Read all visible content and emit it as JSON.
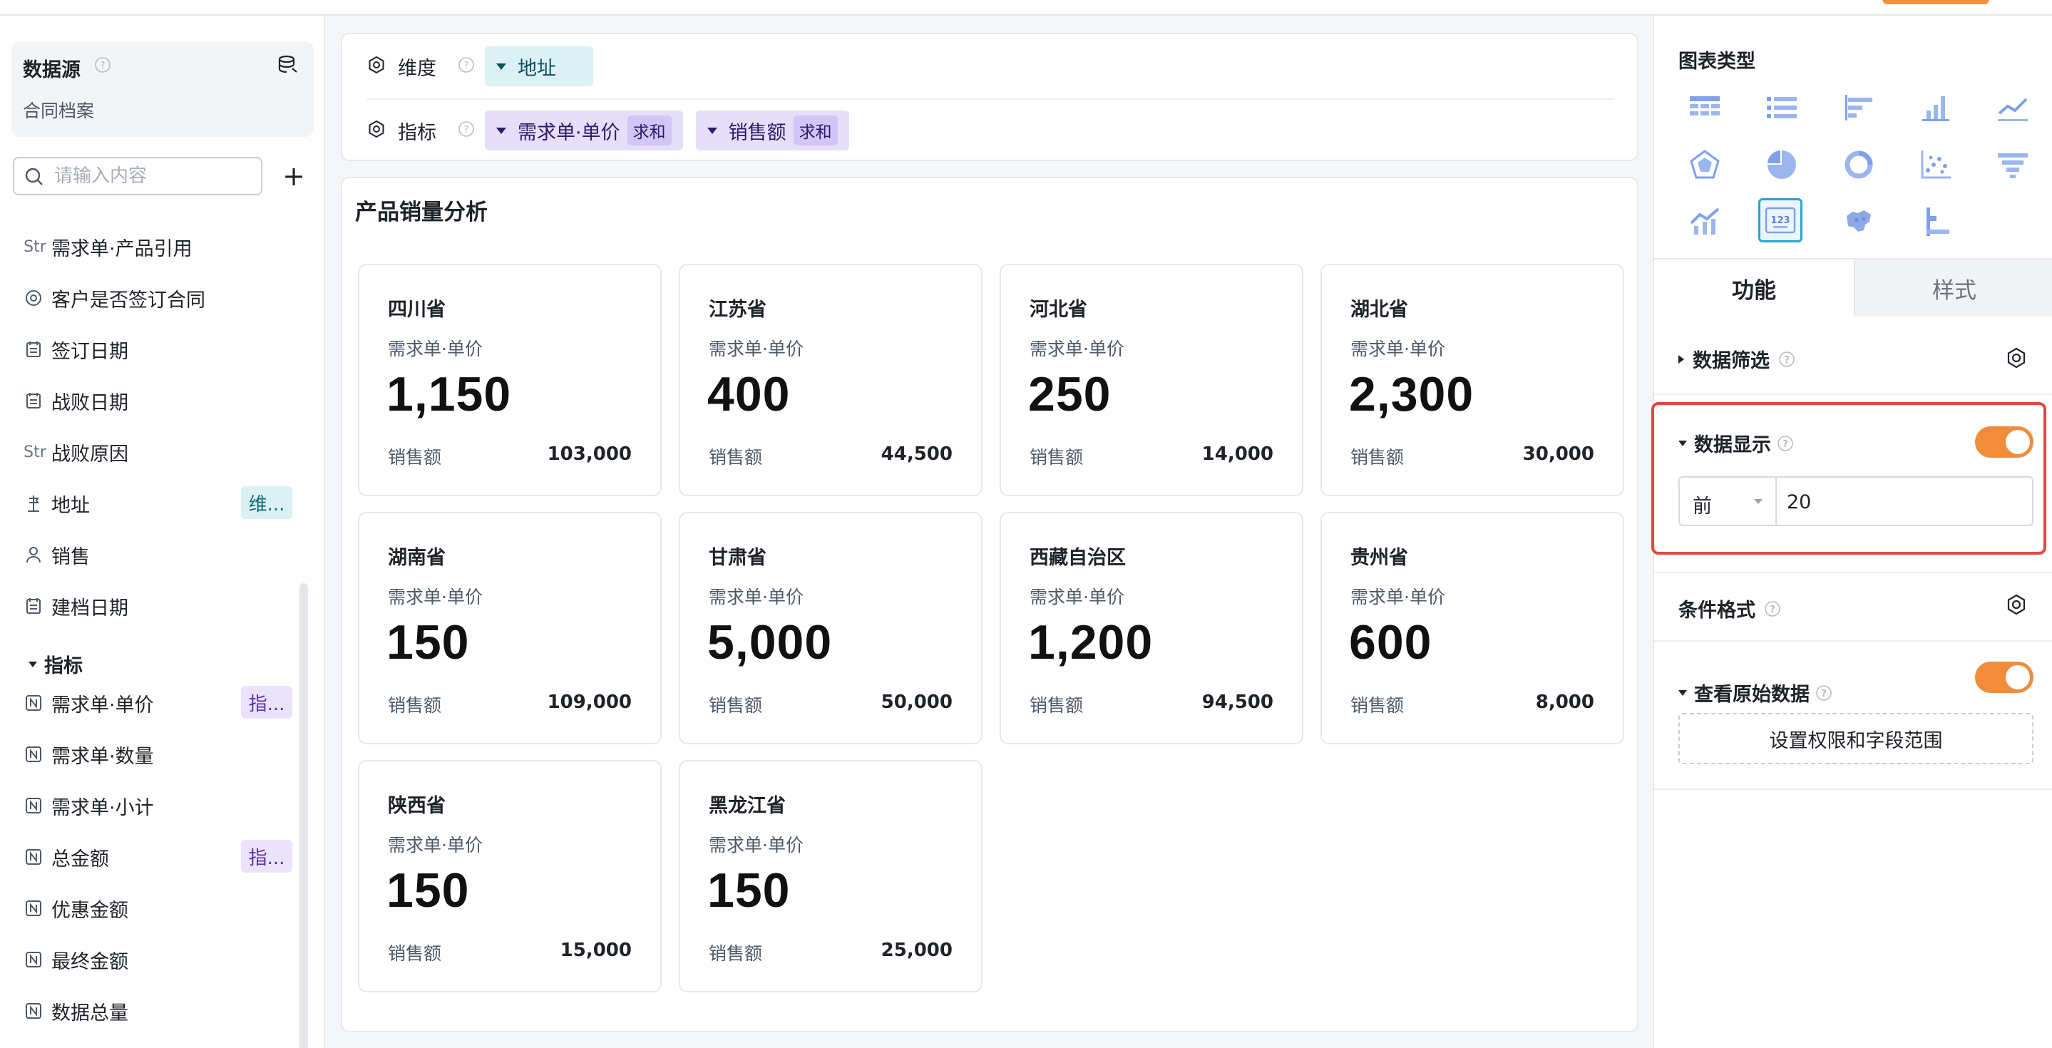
{
  "sidebar": {
    "datasource_title": "数据源",
    "datasource_name": "合同档案",
    "search_placeholder": "请输入内容",
    "fields": [
      {
        "type": "Str",
        "label": "需求单·产品引用",
        "icon": "string-icon",
        "tag": ""
      },
      {
        "type": "enum",
        "label": "客户是否签订合同",
        "icon": "enum-icon",
        "tag": ""
      },
      {
        "type": "date",
        "label": "签订日期",
        "icon": "calendar-icon",
        "tag": ""
      },
      {
        "type": "date",
        "label": "战败日期",
        "icon": "calendar-icon",
        "tag": ""
      },
      {
        "type": "Str",
        "label": "战败原因",
        "icon": "string-icon",
        "tag": ""
      },
      {
        "type": "geo",
        "label": "地址",
        "icon": "location-icon",
        "tag": "维..."
      },
      {
        "type": "user",
        "label": "销售",
        "icon": "user-icon",
        "tag": ""
      },
      {
        "type": "date",
        "label": "建档日期",
        "icon": "calendar-icon",
        "tag": ""
      }
    ],
    "metrics_section": "指标",
    "metrics": [
      {
        "label": "需求单·单价",
        "icon": "number-icon",
        "tag": "指..."
      },
      {
        "label": "需求单·数量",
        "icon": "number-icon",
        "tag": ""
      },
      {
        "label": "需求单·小计",
        "icon": "number-icon",
        "tag": ""
      },
      {
        "label": "总金额",
        "icon": "number-icon",
        "tag": "指..."
      },
      {
        "label": "优惠金额",
        "icon": "number-icon",
        "tag": ""
      },
      {
        "label": "最终金额",
        "icon": "number-icon",
        "tag": ""
      },
      {
        "label": "数据总量",
        "icon": "number-icon",
        "tag": ""
      }
    ]
  },
  "config": {
    "dimension_label": "维度",
    "dimension_pill": "地址",
    "metric_label": "指标",
    "metric_pills": [
      {
        "label": "需求单·单价",
        "agg": "求和"
      },
      {
        "label": "销售额",
        "agg": "求和"
      }
    ]
  },
  "panel": {
    "title": "产品销量分析",
    "cards": [
      {
        "province": "四川省",
        "metric": "需求单·单价",
        "value": "1,150",
        "sub_label": "销售额",
        "sub_value": "103,000"
      },
      {
        "province": "江苏省",
        "metric": "需求单·单价",
        "value": "400",
        "sub_label": "销售额",
        "sub_value": "44,500"
      },
      {
        "province": "河北省",
        "metric": "需求单·单价",
        "value": "250",
        "sub_label": "销售额",
        "sub_value": "14,000"
      },
      {
        "province": "湖北省",
        "metric": "需求单·单价",
        "value": "2,300",
        "sub_label": "销售额",
        "sub_value": "30,000"
      },
      {
        "province": "湖南省",
        "metric": "需求单·单价",
        "value": "150",
        "sub_label": "销售额",
        "sub_value": "109,000"
      },
      {
        "province": "甘肃省",
        "metric": "需求单·单价",
        "value": "5,000",
        "sub_label": "销售额",
        "sub_value": "50,000"
      },
      {
        "province": "西藏自治区",
        "metric": "需求单·单价",
        "value": "1,200",
        "sub_label": "销售额",
        "sub_value": "94,500"
      },
      {
        "province": "贵州省",
        "metric": "需求单·单价",
        "value": "600",
        "sub_label": "销售额",
        "sub_value": "8,000"
      },
      {
        "province": "陕西省",
        "metric": "需求单·单价",
        "value": "150",
        "sub_label": "销售额",
        "sub_value": "15,000"
      },
      {
        "province": "黑龙江省",
        "metric": "需求单·单价",
        "value": "150",
        "sub_label": "销售额",
        "sub_value": "25,000"
      }
    ]
  },
  "right": {
    "chart_type_title": "图表类型",
    "chart_types": [
      "table-icon",
      "list-icon",
      "horizontal-bar-icon",
      "bar-chart-icon",
      "line-chart-icon",
      "radar-icon",
      "pie-icon",
      "donut-icon",
      "scatter-icon",
      "funnel-icon",
      "combo-chart-icon",
      "indicator-card-icon",
      "map-icon",
      "gantt-icon"
    ],
    "selected_chart_type": "indicator-card-icon",
    "indicator_text": "123",
    "tab_function": "功能",
    "tab_style": "样式",
    "filter_label": "数据筛选",
    "display_label": "数据显示",
    "display_enabled": true,
    "topn_select": "前",
    "topn_value": "20",
    "conditional_label": "条件格式",
    "raw_data_label": "查看原始数据",
    "raw_data_enabled": true,
    "permission_button": "设置权限和字段范围",
    "accent_color": "#f08c3a",
    "highlight_color": "#e0483e"
  }
}
